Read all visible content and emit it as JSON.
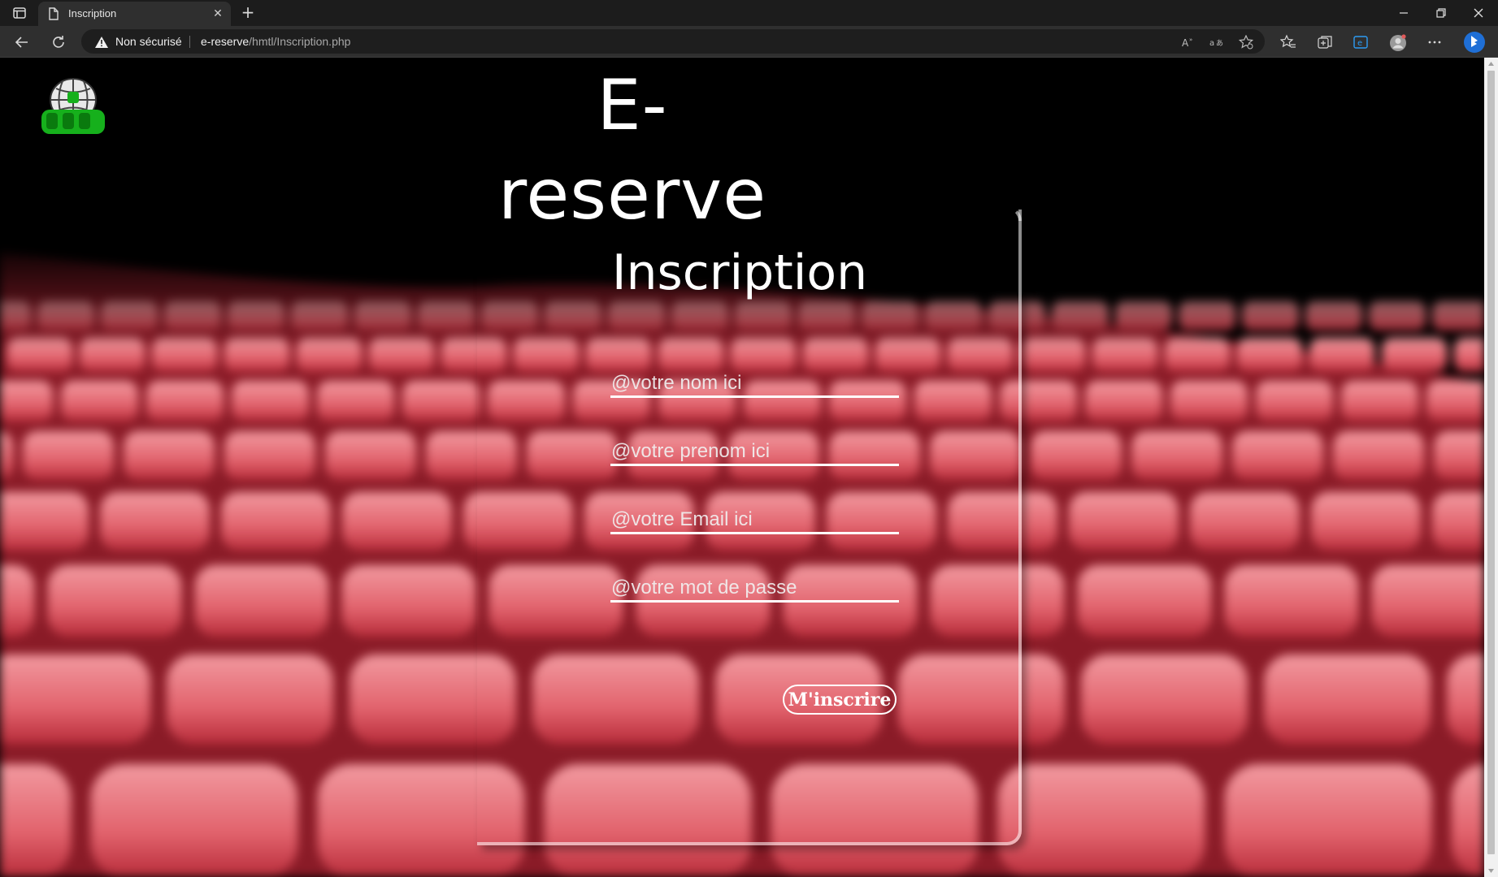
{
  "browser": {
    "tab_title": "Inscription",
    "security_label": "Non sécurisé",
    "url_host": "e-reserve",
    "url_path": "/hmtl/Inscription.php"
  },
  "header": {
    "site_title": "E-reserve"
  },
  "form": {
    "title": "Inscription",
    "fields": [
      {
        "placeholder": "@votre nom ici"
      },
      {
        "placeholder": "@votre prenom ici"
      },
      {
        "placeholder": "@votre Email ici"
      },
      {
        "placeholder": "@votre mot de passe"
      }
    ],
    "submit_label": "M'inscrire"
  },
  "colors": {
    "page_background": "#000000",
    "seat_red": "#d9535f",
    "text": "#ffffff",
    "browser_chrome": "#2f2f2f"
  }
}
